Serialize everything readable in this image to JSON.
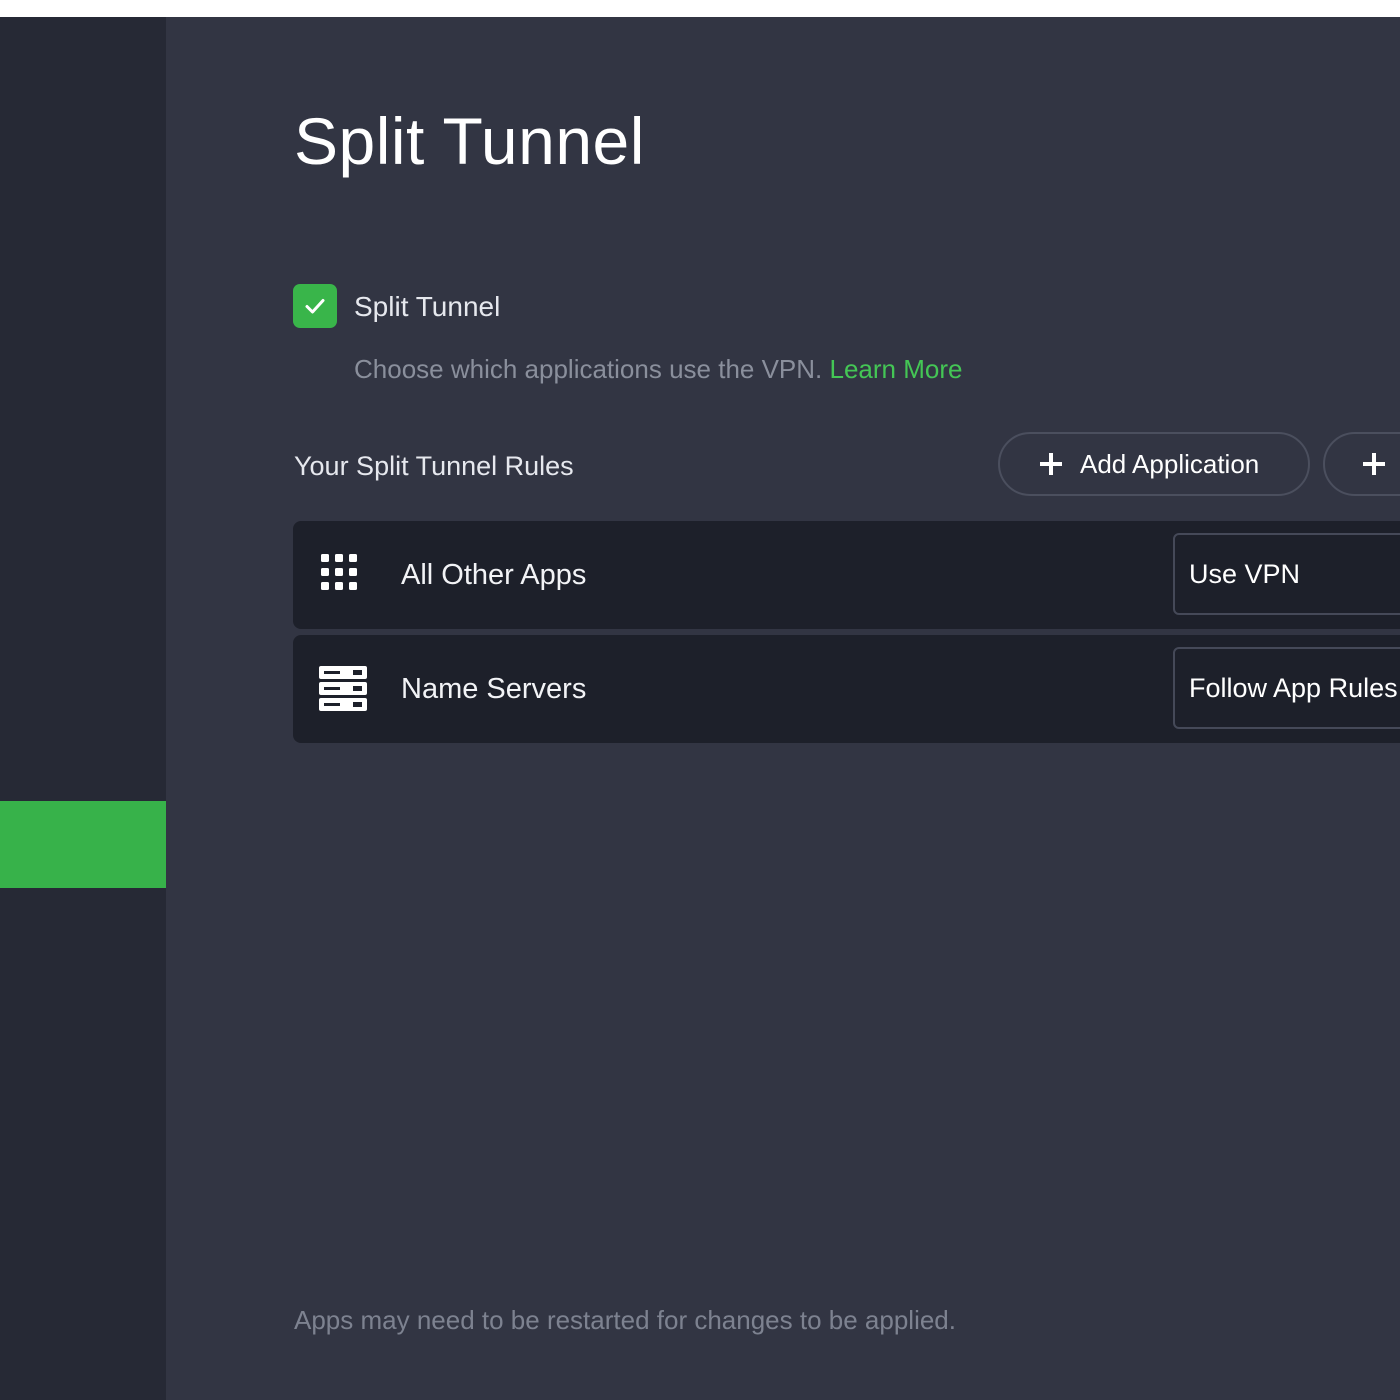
{
  "page": {
    "title": "Split Tunnel"
  },
  "split_tunnel": {
    "checkbox_label": "Split Tunnel",
    "checked": true,
    "description": "Choose which applications use the VPN.",
    "learn_more": "Learn More"
  },
  "rules": {
    "heading": "Your Split Tunnel Rules",
    "add_application_label": "Add Application",
    "add_other_label": "",
    "items": [
      {
        "label": "All Other Apps",
        "icon": "grid-apps-icon",
        "value": "Use VPN"
      },
      {
        "label": "Name Servers",
        "icon": "server-rack-icon",
        "value": "Follow App Rules"
      }
    ]
  },
  "footer": {
    "note": "Apps may need to be restarted for changes to be applied."
  },
  "colors": {
    "accent": "#39b54a",
    "background": "#323543",
    "sidebar": "#262935",
    "row": "#1d202a"
  }
}
